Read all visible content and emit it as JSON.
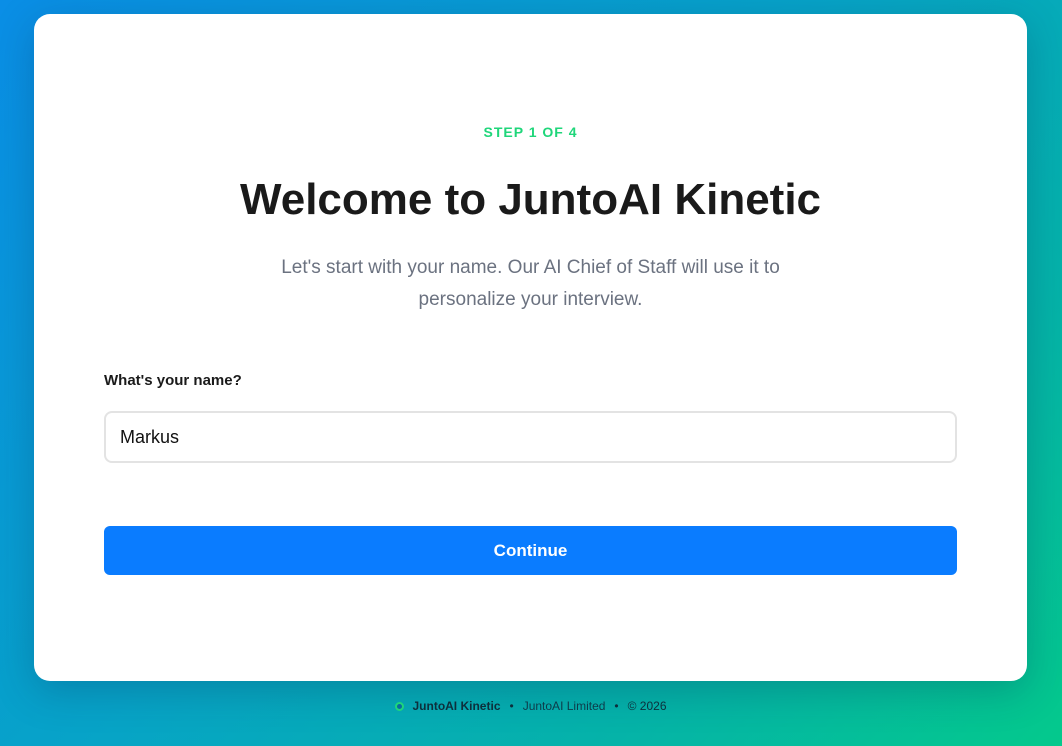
{
  "step": {
    "text": "STEP 1 OF 4"
  },
  "header": {
    "title": "Welcome to JuntoAI Kinetic",
    "subtitle": "Let's start with your name. Our AI Chief of Staff will use it to personalize your interview."
  },
  "form": {
    "name_label": "What's your name?",
    "name_value": "Markus",
    "continue_label": "Continue"
  },
  "footer": {
    "brand": "JuntoAI Kinetic",
    "company": "JuntoAI Limited",
    "copyright": "© 2026",
    "separator": "•"
  },
  "colors": {
    "accent": "#0a7cff",
    "step": "#1fd67a"
  },
  "icons": {
    "footer_logo": "circle-logo-icon"
  }
}
